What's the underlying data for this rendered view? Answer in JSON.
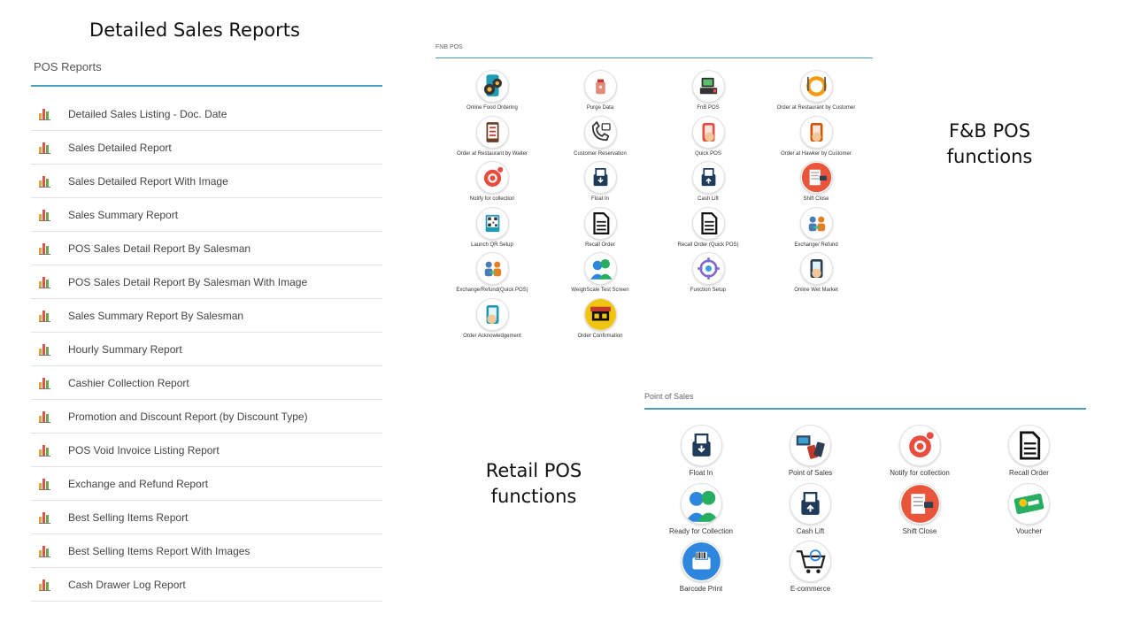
{
  "captions": {
    "sales_reports": "Detailed Sales Reports",
    "fnb_line1": "F&B POS",
    "fnb_line2": "functions",
    "retail_line1": "Retail POS",
    "retail_line2": "functions"
  },
  "pos_reports": {
    "title": "POS Reports",
    "items": [
      "Detailed Sales Listing - Doc. Date",
      "Sales Detailed Report",
      "Sales Detailed Report With Image",
      "Sales Summary Report",
      "POS Sales Detail Report By Salesman",
      "POS Sales Detail Report By Salesman With Image",
      "Sales Summary Report By Salesman",
      "Hourly Summary Report",
      "Cashier Collection Report",
      "Promotion and Discount Report (by Discount Type)",
      "POS Void Invoice Listing Report",
      "Exchange and Refund Report",
      "Best Selling Items Report",
      "Best Selling Items Report With Images",
      "Cash Drawer Log Report"
    ]
  },
  "fnb_pos": {
    "title": "FNB POS",
    "tiles": [
      {
        "label": "Online Food Ordering",
        "icon": "online-food-ordering-icon"
      },
      {
        "label": "Purge Data",
        "icon": "purge-data-icon"
      },
      {
        "label": "FnB POS",
        "icon": "fnb-pos-icon"
      },
      {
        "label": "Order at Restaurant by Customer",
        "icon": "restaurant-customer-icon"
      },
      {
        "label": "Order at Restaurant by Waiter",
        "icon": "restaurant-waiter-icon"
      },
      {
        "label": "Customer Reservation",
        "icon": "reservation-icon"
      },
      {
        "label": "Quick POS",
        "icon": "quick-pos-icon"
      },
      {
        "label": "Order at Hawker by Customer",
        "icon": "hawker-order-icon"
      },
      {
        "label": "Notify for collection",
        "icon": "notify-icon"
      },
      {
        "label": "Float In",
        "icon": "float-in-icon"
      },
      {
        "label": "Cash Lift",
        "icon": "cash-lift-icon"
      },
      {
        "label": "Shift Close",
        "icon": "shift-close-icon"
      },
      {
        "label": "Launch QR Setup",
        "icon": "qr-setup-icon"
      },
      {
        "label": "Recall Order",
        "icon": "recall-order-icon"
      },
      {
        "label": "Recall Order (Quick POS)",
        "icon": "recall-order-quick-icon"
      },
      {
        "label": "Exchange/ Refund",
        "icon": "exchange-refund-icon"
      },
      {
        "label": "Exchange/Refund(Quick POS)",
        "icon": "exchange-refund-quick-icon"
      },
      {
        "label": "WeighScale Test Screen",
        "icon": "weighscale-icon"
      },
      {
        "label": "Function Setup",
        "icon": "function-setup-icon"
      },
      {
        "label": "Online Wet Market",
        "icon": "wet-market-icon"
      },
      {
        "label": "Order Acknowledgement",
        "icon": "order-ack-icon"
      },
      {
        "label": "Order Confirmation",
        "icon": "order-confirmation-icon"
      }
    ]
  },
  "retail_pos": {
    "title": "Point of Sales",
    "tiles": [
      {
        "label": "Float In",
        "icon": "float-in-icon"
      },
      {
        "label": "Point of Sales",
        "icon": "point-of-sales-icon"
      },
      {
        "label": "Notify for collection",
        "icon": "notify-icon"
      },
      {
        "label": "Recall Order",
        "icon": "recall-order-icon"
      },
      {
        "label": "Ready for Collection",
        "icon": "ready-collection-icon"
      },
      {
        "label": "Cash Lift",
        "icon": "cash-lift-icon"
      },
      {
        "label": "Shift Close",
        "icon": "shift-close-icon"
      },
      {
        "label": "Voucher",
        "icon": "voucher-icon"
      },
      {
        "label": "Barcode Print",
        "icon": "barcode-print-icon"
      },
      {
        "label": "E-commerce",
        "icon": "ecommerce-icon"
      }
    ]
  },
  "colors": {
    "accent_line": "#4a9fbe",
    "report_icon": [
      "#e5a43a",
      "#d9534f",
      "#6aa84f"
    ]
  }
}
